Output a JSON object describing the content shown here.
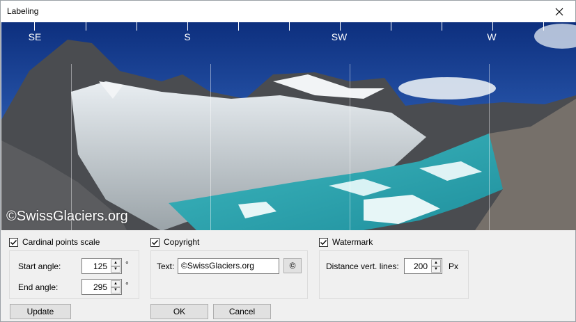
{
  "window": {
    "title": "Labeling"
  },
  "preview": {
    "directions": [
      "SE",
      "S",
      "SW",
      "W"
    ],
    "watermark_text": "©SwissGlaciers.org"
  },
  "cardinal": {
    "label": "Cardinal points scale",
    "checked": true,
    "start_label": "Start angle:",
    "start_value": "125",
    "end_label": "End angle:",
    "end_value": "295",
    "unit": "°"
  },
  "copyright": {
    "label": "Copyright",
    "checked": true,
    "text_label": "Text:",
    "text_value": "©SwissGlaciers.org",
    "symbol_button": "©"
  },
  "watermark": {
    "label": "Watermark",
    "checked": true,
    "distance_label": "Distance vert. lines:",
    "distance_value": "200",
    "unit": "Px"
  },
  "buttons": {
    "update": "Update",
    "ok": "OK",
    "cancel": "Cancel"
  }
}
